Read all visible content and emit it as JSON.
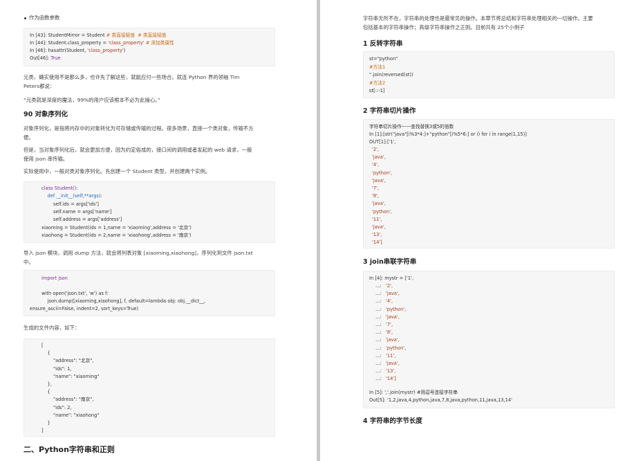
{
  "left_page": {
    "bullet": "作为函数参数",
    "code1": [
      {
        "p": "In [43]: StudentMirror = Student ",
        "c": "# 类直接赋值  # 类直接赋值"
      },
      {
        "p": "In [44]: Student.class_property = ",
        "s": "'class_property'",
        "c": " # 添加类属性"
      },
      {
        "p": "In [46]: hasattr(Student, ",
        "s": "'class_property'",
        "e": ")"
      },
      {
        "p": "Out[46]: ",
        "k": "True"
      }
    ],
    "para1a": "元类，确实使用不是那么多，也许先了解这些，就能应付一些场合。就连 Python 界的领袖 Tim",
    "para1b": "Peters都说：",
    "quote": "“元类就是深度的魔法，99%的用户应该根本不必为此操心。”",
    "h90": "90 对象序列化",
    "para2a": "对象序列化，是指将内存中的对象转化为可存储或传输的过程。很多场景，直接一个类对象，传输不方",
    "para2b": "便。",
    "para3a": "但是，当对象序列化后，就会更加方便，因为约定俗成的，接口间的调用或者发起的 web 请求，一般",
    "para3b": "使用 json 串传输。",
    "para4": "实际使用中，一般对类对象序列化。先创建一个 Student 类型，并创建两个实例。",
    "code2": [
      "class Student():",
      "    def __init__(self,**args):",
      "        self.ids = args['ids']",
      "        self.name = args['name']",
      "        self.address = args['address']",
      "xiaoming = Student(ids = 1,name = 'xiaoming',address = '北京')",
      "xiaohong = Student(ids = 2,name = 'xiaohong',address = '南京')"
    ],
    "para5a": "导入 json 模块，调用 dump 方法，就会将列表对象 [xiaoming,xiaohong]，序列化到文件 json.txt",
    "para5b": "中。",
    "code3": [
      "import json",
      "",
      "with open('json.txt', 'w') as f:",
      "    json.dump([xiaoming,xiaohong], f, default=lambda obj: obj.__dict__,",
      "ensure_ascii=False, indent=2, sort_keys=True)"
    ],
    "para6": "生成的文件内容，如下：",
    "code4": [
      "[",
      "    {",
      "        \"address\": \"北京\",",
      "        \"ids\": 1,",
      "        \"name\": \"xiaoming\"",
      "    },",
      "    {",
      "        \"address\": \"南京\",",
      "        \"ids\": 2,",
      "        \"name\": \"xiaohong\"",
      "    }",
      "]"
    ],
    "section": "二、Python字符串和正则"
  },
  "right_page": {
    "intro_a": "字符串无所不在，字符串的处理也是最常见的操作。本章节将总结和字符串处理相关的一切操作。主要",
    "intro_b": "包括基本的字符串操作；高级字符串操作之正则。目前共有 25个小例子",
    "h1": "1 反转字符串",
    "code1": [
      "st=\"python\"",
      "#方法1",
      "''.join(reversed(st))",
      "#方法2",
      "st[::-1]"
    ],
    "h2": "2 字符串切片操作",
    "code2_title": "字符串切片操作——查找替换3或5的倍数",
    "code2_line": "In [1]:[str(\"java\"[i%3*4:]+\"python\"[i%5*6:] or i) for i in range(1,15)]",
    "code2_out": "OUT[1]:['1',",
    "code2_items": [
      "'2',",
      "'java',",
      "'4',",
      "'python',",
      "'java',",
      "'7',",
      "'8',",
      "'java',",
      "'python',",
      "'11',",
      "'java',",
      "'13',",
      "'14']"
    ],
    "h3": "3 join串联字符串",
    "code3_first": "In [4]: mystr = ['1',",
    "code3_items": [
      "'2',",
      "'java',",
      "'4',",
      "'python',",
      "'java',",
      "'7',",
      "'8',",
      "'java',",
      "'python',",
      "'11',",
      "'java',",
      "'13',",
      "'14']"
    ],
    "code3_cont": "...:",
    "code3_in5": "In [5]: ','.join(mystr) #用逗号连接字符串",
    "code3_out5": "Out[5]: '1,2,java,4,python,java,7,8,java,python,11,java,13,14'",
    "h4": "4 字符串的字节长度"
  }
}
